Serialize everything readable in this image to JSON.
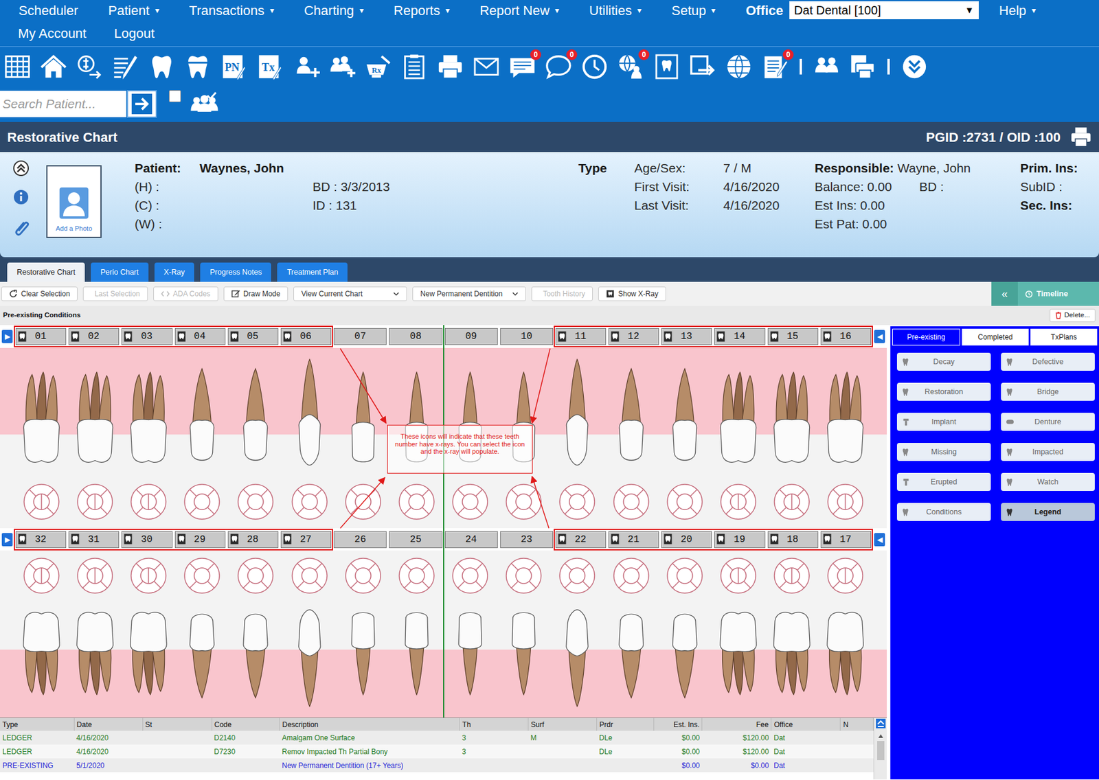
{
  "menu": {
    "items": [
      {
        "label": "Scheduler"
      },
      {
        "label": "Patient",
        "caret": "▾"
      },
      {
        "label": "Transactions",
        "caret": "▾"
      },
      {
        "label": "Charting",
        "caret": "▾"
      },
      {
        "label": "Reports",
        "caret": "▾"
      },
      {
        "label": "Report New",
        "caret": "▾"
      },
      {
        "label": "Utilities",
        "caret": "▾"
      },
      {
        "label": "Setup",
        "caret": "▾"
      }
    ],
    "office_label": "Office",
    "office_value": "Dat Dental [100]",
    "office_caret": "▼",
    "help": {
      "label": "Help",
      "caret": "▾"
    },
    "second": [
      "My Account",
      "Logout"
    ]
  },
  "toolbar": [
    {
      "kind": "calendar"
    },
    {
      "kind": "home"
    },
    {
      "kind": "ledger"
    },
    {
      "kind": "notes"
    },
    {
      "kind": "tooth"
    },
    {
      "kind": "crown"
    },
    {
      "kind": "label",
      "text": "PN"
    },
    {
      "kind": "label",
      "text": "Tx"
    },
    {
      "kind": "adduser"
    },
    {
      "kind": "addfamily"
    },
    {
      "kind": "rx",
      "text": "Rx"
    },
    {
      "kind": "list"
    },
    {
      "kind": "printer"
    },
    {
      "kind": "mail"
    },
    {
      "kind": "message",
      "badge": "0"
    },
    {
      "kind": "chat",
      "badge": "0"
    },
    {
      "kind": "clock"
    },
    {
      "kind": "webuser",
      "badge": "0"
    },
    {
      "kind": "xray"
    },
    {
      "kind": "export"
    },
    {
      "kind": "globe"
    },
    {
      "kind": "form",
      "badge": "0"
    },
    {
      "kind": "separator"
    },
    {
      "kind": "group"
    },
    {
      "kind": "printmulti"
    },
    {
      "kind": "separator"
    },
    {
      "kind": "more"
    }
  ],
  "search": {
    "placeholder": "Search Patient...",
    "checked": false
  },
  "header": {
    "title": "Restorative Chart",
    "ids": "PGID :2731  /  OID :100"
  },
  "patient": {
    "photo_caption": "Add a Photo",
    "name_label": "Patient:",
    "name": "Waynes, John",
    "phones": [
      "(H) :",
      "(C) :",
      "(W) :"
    ],
    "bd": "BD : 3/3/2013",
    "id": "ID : 131",
    "type_label": "Type",
    "stats": [
      {
        "label": "Age/Sex:",
        "value": "7 / M"
      },
      {
        "label": "First Visit:",
        "value": "4/16/2020"
      },
      {
        "label": "Last Visit:",
        "value": "4/16/2020"
      }
    ],
    "responsible_label": "Responsible:",
    "responsible": "Wayne, John",
    "balance": "Balance: 0.00",
    "resp_bd": "BD :",
    "est_ins": "Est Ins:  0.00",
    "est_pat": "Est Pat: 0.00",
    "prim_ins": "Prim. Ins:",
    "sub_id": "SubID :",
    "sec_ins": "Sec. Ins:"
  },
  "tabs": [
    {
      "label": "Restorative Chart",
      "selected": true
    },
    {
      "label": "Perio Chart",
      "selected": false
    },
    {
      "label": "X-Ray",
      "selected": false
    },
    {
      "label": "Progress Notes",
      "selected": false
    },
    {
      "label": "Treatment Plan",
      "selected": false
    }
  ],
  "chart_toolbar": [
    {
      "label": "Clear Selection",
      "kind": "refresh",
      "disabled": false
    },
    {
      "label": "Last Selection",
      "kind": "plain",
      "disabled": true
    },
    {
      "label": "ADA Codes",
      "kind": "code",
      "disabled": true
    },
    {
      "label": "Draw Mode",
      "kind": "edit",
      "disabled": false
    },
    {
      "label": "View Current Chart",
      "kind": "select",
      "disabled": false
    },
    {
      "label": "New Permanent Dentition",
      "kind": "select",
      "disabled": false
    },
    {
      "label": "Tooth History",
      "kind": "plain",
      "disabled": true
    },
    {
      "label": "Show X-Ray",
      "kind": "xray",
      "disabled": false
    }
  ],
  "timeline": {
    "collapse": "«",
    "label": "Timeline"
  },
  "section": {
    "title": "Pre-existing Conditions",
    "delete": "Delete..."
  },
  "chart": {
    "nav_left": "▶",
    "nav_right": "◀",
    "upper": [
      {
        "number": "01",
        "kind": "molar",
        "xray": true
      },
      {
        "number": "02",
        "kind": "molar",
        "xray": true
      },
      {
        "number": "03",
        "kind": "molar",
        "xray": true
      },
      {
        "number": "04",
        "kind": "premolar",
        "xray": true
      },
      {
        "number": "05",
        "kind": "premolar",
        "xray": true
      },
      {
        "number": "06",
        "kind": "canine",
        "xray": true
      },
      {
        "number": "07",
        "kind": "incisor",
        "xray": false
      },
      {
        "number": "08",
        "kind": "incisor",
        "xray": false
      },
      {
        "number": "09",
        "kind": "incisor",
        "xray": false
      },
      {
        "number": "10",
        "kind": "incisor",
        "xray": false
      },
      {
        "number": "11",
        "kind": "canine",
        "xray": true
      },
      {
        "number": "12",
        "kind": "premolar",
        "xray": true
      },
      {
        "number": "13",
        "kind": "premolar",
        "xray": true
      },
      {
        "number": "14",
        "kind": "molar",
        "xray": true
      },
      {
        "number": "15",
        "kind": "molar",
        "xray": true
      },
      {
        "number": "16",
        "kind": "molar",
        "xray": true
      }
    ],
    "lower": [
      {
        "number": "32",
        "kind": "molar",
        "xray": true
      },
      {
        "number": "31",
        "kind": "molar",
        "xray": true
      },
      {
        "number": "30",
        "kind": "molar",
        "xray": true
      },
      {
        "number": "29",
        "kind": "premolar",
        "xray": true
      },
      {
        "number": "28",
        "kind": "premolar",
        "xray": true
      },
      {
        "number": "27",
        "kind": "canine",
        "xray": true
      },
      {
        "number": "26",
        "kind": "incisor",
        "xray": false
      },
      {
        "number": "25",
        "kind": "incisor",
        "xray": false
      },
      {
        "number": "24",
        "kind": "incisor",
        "xray": false
      },
      {
        "number": "23",
        "kind": "incisor",
        "xray": false
      },
      {
        "number": "22",
        "kind": "canine",
        "xray": true
      },
      {
        "number": "21",
        "kind": "premolar",
        "xray": true
      },
      {
        "number": "20",
        "kind": "premolar",
        "xray": true
      },
      {
        "number": "19",
        "kind": "molar",
        "xray": true
      },
      {
        "number": "18",
        "kind": "molar",
        "xray": true
      },
      {
        "number": "17",
        "kind": "molar",
        "xray": true
      }
    ]
  },
  "annotation": {
    "text": "These icons will indicate that these teeth number have x-rays. You can select the icon and the x-ray will populate."
  },
  "side_panel": {
    "tabs": [
      {
        "label": "Pre-existing",
        "selected": true
      },
      {
        "label": "Completed",
        "selected": false
      },
      {
        "label": "TxPlans",
        "selected": false
      }
    ],
    "buttons": [
      {
        "label": "Decay",
        "kind": "tooth",
        "selected": false
      },
      {
        "label": "Defective",
        "kind": "tooth",
        "selected": false
      },
      {
        "label": "Restoration",
        "kind": "tooth",
        "selected": false
      },
      {
        "label": "Bridge",
        "kind": "tooth",
        "selected": false
      },
      {
        "label": "Implant",
        "kind": "implant",
        "selected": false
      },
      {
        "label": "Denture",
        "kind": "denture",
        "selected": false
      },
      {
        "label": "Missing",
        "kind": "tooth",
        "selected": false
      },
      {
        "label": "Impacted",
        "kind": "tooth",
        "selected": false
      },
      {
        "label": "Erupted",
        "kind": "implant",
        "selected": false
      },
      {
        "label": "Watch",
        "kind": "tooth",
        "selected": false
      },
      {
        "label": "Conditions",
        "kind": "tooth",
        "selected": false
      },
      {
        "label": "Legend",
        "kind": "tooth",
        "selected": true
      }
    ]
  },
  "ledger": {
    "columns": [
      "Type",
      "Date",
      "St",
      "Code",
      "Description",
      "Th",
      "Surf",
      "Prdr",
      "Est. Ins.",
      "Fee",
      "Office",
      "N"
    ],
    "rows": [
      {
        "cells": [
          "LEDGER",
          "4/16/2020",
          "",
          "D2140",
          "Amalgam One Surface",
          "3",
          "M",
          "DLe",
          "$0.00",
          "$120.00",
          "Dat",
          ""
        ],
        "color": "#1f7a24"
      },
      {
        "cells": [
          "LEDGER",
          "4/16/2020",
          "",
          "D7230",
          "Remov Impacted Th Partial Bony",
          "3",
          "",
          "DLe",
          "$0.00",
          "$120.00",
          "Dat",
          ""
        ],
        "color": "#1f7a24"
      },
      {
        "cells": [
          "PRE-EXISTING",
          "5/1/2020",
          "",
          "",
          "New Permanent Dentition (17+ Years)",
          "",
          "",
          "",
          "$0.00",
          "$0.00",
          "Dat",
          ""
        ],
        "color": "#2323d6"
      }
    ]
  }
}
